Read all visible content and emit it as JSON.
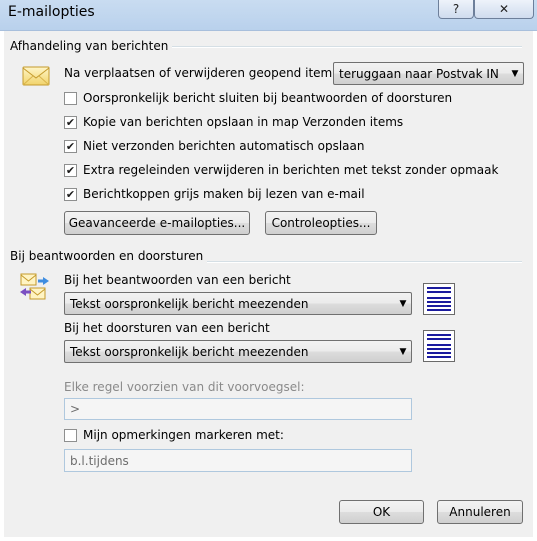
{
  "window": {
    "title": "E-mailopties",
    "help_glyph": "?",
    "close_glyph": "✕"
  },
  "handling": {
    "group_label": "Afhandeling van berichten",
    "move_label": "Na verplaatsen of verwijderen geopend item:",
    "move_value": "teruggaan naar Postvak IN",
    "checkboxes": [
      {
        "label": "Oorspronkelijk bericht sluiten bij beantwoorden of doorsturen",
        "checked": false
      },
      {
        "label": "Kopie van berichten opslaan in map Verzonden items",
        "checked": true
      },
      {
        "label": "Niet verzonden berichten automatisch opslaan",
        "checked": true
      },
      {
        "label": "Extra regeleinden verwijderen in berichten met tekst zonder opmaak",
        "checked": true
      },
      {
        "label": "Berichtkoppen grijs maken bij lezen van e-mail",
        "checked": true
      }
    ],
    "advanced_button": "Geavanceerde e-mailopties...",
    "tracking_button": "Controleopties..."
  },
  "reply": {
    "group_label": "Bij beantwoorden en doorsturen",
    "reply_label": "Bij het beantwoorden van een bericht",
    "reply_value": "Tekst oorspronkelijk bericht meezenden",
    "forward_label": "Bij het doorsturen van een bericht",
    "forward_value": "Tekst oorspronkelijk bericht meezenden",
    "prefix_label": "Elke regel voorzien van dit voorvoegsel:",
    "prefix_value": ">",
    "mark_label": "Mijn opmerkingen markeren met:",
    "mark_checked": false,
    "mark_value": "b.l.tijdens"
  },
  "footer": {
    "ok": "OK",
    "cancel": "Annuleren"
  }
}
